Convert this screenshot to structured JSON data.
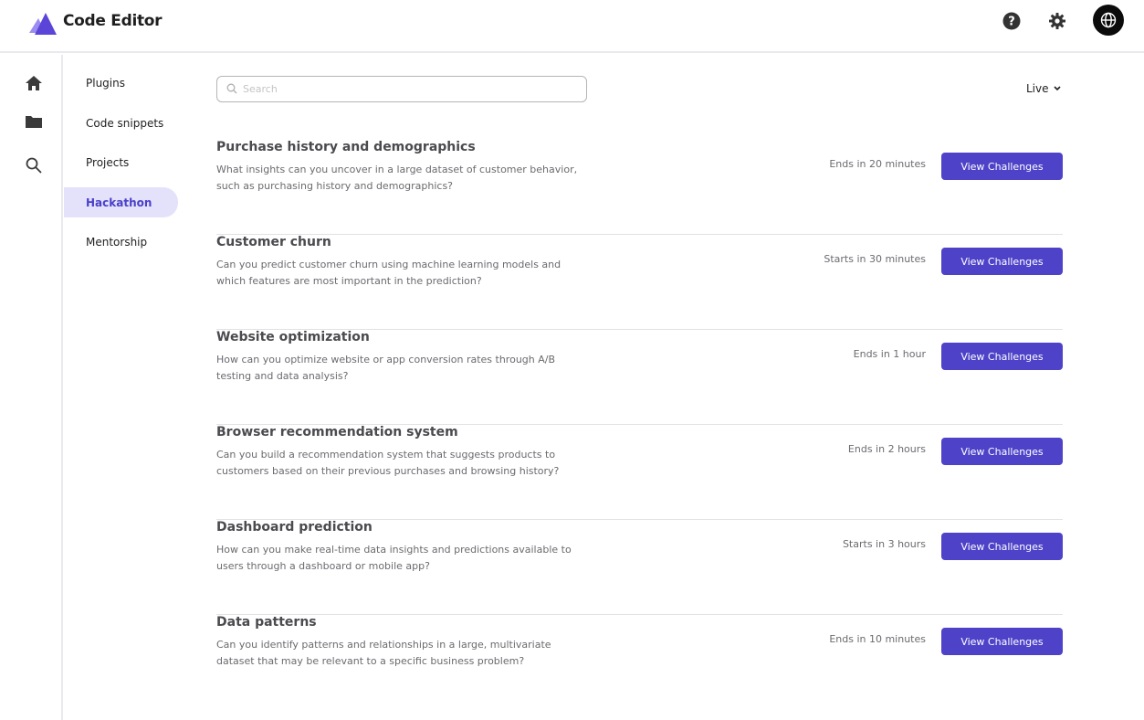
{
  "app": {
    "title": "Code Editor"
  },
  "header_icons": [
    "help-icon",
    "gear-icon",
    "globe-icon"
  ],
  "rail": [
    "home-icon",
    "folder-icon",
    "search-icon"
  ],
  "nav": {
    "items": [
      {
        "label": "Plugins",
        "active": false
      },
      {
        "label": "Code snippets",
        "active": false
      },
      {
        "label": "Projects",
        "active": false
      },
      {
        "label": "Hackathon",
        "active": true
      },
      {
        "label": "Mentorship",
        "active": false
      }
    ]
  },
  "search": {
    "placeholder": "Search",
    "value": ""
  },
  "filter": {
    "label": "Live"
  },
  "colors": {
    "accent": "#4e43c8",
    "active_bg": "#e4e2fb",
    "active_text": "#4a40c9"
  },
  "challenges": [
    {
      "title": "Purchase history and demographics",
      "description": "What insights can you uncover in a large dataset of customer behavior, such as purchasing history and demographics?",
      "status": "Ends in 20 minutes",
      "button": "View Challenges"
    },
    {
      "title": "Customer churn",
      "description": "Can you predict customer churn using machine learning models and which features are most important in the prediction?",
      "status": "Starts in 30 minutes",
      "button": "View Challenges"
    },
    {
      "title": "Website optimization",
      "description": "How can you optimize website or app conversion rates through A/B testing and data analysis?",
      "status": "Ends in 1 hour",
      "button": "View Challenges"
    },
    {
      "title": "Browser recommendation system",
      "description": "Can you build a recommendation system that suggests products to customers based on their previous purchases and browsing history?",
      "status": "Ends in 2 hours",
      "button": "View Challenges"
    },
    {
      "title": "Dashboard prediction",
      "description": "How can you make real-time data insights and predictions available to users through a dashboard or mobile app?",
      "status": "Starts in 3 hours",
      "button": "View Challenges"
    },
    {
      "title": "Data patterns",
      "description": "Can you identify patterns and relationships in a large, multivariate dataset that may be relevant to a specific business problem?",
      "status": "Ends in 10 minutes",
      "button": "View Challenges"
    }
  ]
}
